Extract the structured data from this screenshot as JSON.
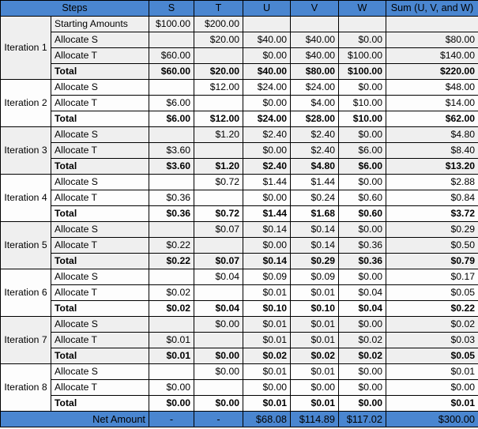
{
  "table": {
    "headers": [
      "Steps",
      "S",
      "T",
      "U",
      "V",
      "W",
      "Sum (U, V, and W)"
    ],
    "colors": {
      "header_blue": "#4a86d0",
      "footer_blue": "#4a86d0",
      "row_shade": "#efefef",
      "row_plain": "#fdfdfd",
      "border": "#000000"
    },
    "blocks": [
      {
        "iteration": "Iteration 1",
        "shaded": true,
        "rows": [
          {
            "step": "Starting Amounts",
            "total": false,
            "values": [
              "$100.00",
              "$200.00",
              "",
              "",
              "",
              ""
            ]
          },
          {
            "step": "Allocate S",
            "total": false,
            "values": [
              "",
              "$20.00",
              "$40.00",
              "$40.00",
              "$0.00",
              "$80.00"
            ]
          },
          {
            "step": "Allocate T",
            "total": false,
            "values": [
              "$60.00",
              "",
              "$0.00",
              "$40.00",
              "$100.00",
              "$140.00"
            ]
          },
          {
            "step": "Total",
            "total": true,
            "values": [
              "$60.00",
              "$20.00",
              "$40.00",
              "$80.00",
              "$100.00",
              "$220.00"
            ]
          }
        ]
      },
      {
        "iteration": "Iteration 2",
        "shaded": false,
        "rows": [
          {
            "step": "Allocate S",
            "total": false,
            "values": [
              "",
              "$12.00",
              "$24.00",
              "$24.00",
              "$0.00",
              "$48.00"
            ]
          },
          {
            "step": "Allocate T",
            "total": false,
            "values": [
              "$6.00",
              "",
              "$0.00",
              "$4.00",
              "$10.00",
              "$14.00"
            ]
          },
          {
            "step": "Total",
            "total": true,
            "values": [
              "$6.00",
              "$12.00",
              "$24.00",
              "$28.00",
              "$10.00",
              "$62.00"
            ]
          }
        ]
      },
      {
        "iteration": "Iteration 3",
        "shaded": true,
        "rows": [
          {
            "step": "Allocate S",
            "total": false,
            "values": [
              "",
              "$1.20",
              "$2.40",
              "$2.40",
              "$0.00",
              "$4.80"
            ]
          },
          {
            "step": "Allocate T",
            "total": false,
            "values": [
              "$3.60",
              "",
              "$0.00",
              "$2.40",
              "$6.00",
              "$8.40"
            ]
          },
          {
            "step": "Total",
            "total": true,
            "values": [
              "$3.60",
              "$1.20",
              "$2.40",
              "$4.80",
              "$6.00",
              "$13.20"
            ]
          }
        ]
      },
      {
        "iteration": "Iteration 4",
        "shaded": false,
        "rows": [
          {
            "step": "Allocate S",
            "total": false,
            "values": [
              "",
              "$0.72",
              "$1.44",
              "$1.44",
              "$0.00",
              "$2.88"
            ]
          },
          {
            "step": "Allocate T",
            "total": false,
            "values": [
              "$0.36",
              "",
              "$0.00",
              "$0.24",
              "$0.60",
              "$0.84"
            ]
          },
          {
            "step": "Total",
            "total": true,
            "values": [
              "$0.36",
              "$0.72",
              "$1.44",
              "$1.68",
              "$0.60",
              "$3.72"
            ]
          }
        ]
      },
      {
        "iteration": "Iteration 5",
        "shaded": true,
        "rows": [
          {
            "step": "Allocate S",
            "total": false,
            "values": [
              "",
              "$0.07",
              "$0.14",
              "$0.14",
              "$0.00",
              "$0.29"
            ]
          },
          {
            "step": "Allocate T",
            "total": false,
            "values": [
              "$0.22",
              "",
              "$0.00",
              "$0.14",
              "$0.36",
              "$0.50"
            ]
          },
          {
            "step": "Total",
            "total": true,
            "values": [
              "$0.22",
              "$0.07",
              "$0.14",
              "$0.29",
              "$0.36",
              "$0.79"
            ]
          }
        ]
      },
      {
        "iteration": "Iteration 6",
        "shaded": false,
        "rows": [
          {
            "step": "Allocate S",
            "total": false,
            "values": [
              "",
              "$0.04",
              "$0.09",
              "$0.09",
              "$0.00",
              "$0.17"
            ]
          },
          {
            "step": "Allocate T",
            "total": false,
            "values": [
              "$0.02",
              "",
              "$0.01",
              "$0.01",
              "$0.04",
              "$0.05"
            ]
          },
          {
            "step": "Total",
            "total": true,
            "values": [
              "$0.02",
              "$0.04",
              "$0.10",
              "$0.10",
              "$0.04",
              "$0.22"
            ]
          }
        ]
      },
      {
        "iteration": "Iteration 7",
        "shaded": true,
        "rows": [
          {
            "step": "Allocate S",
            "total": false,
            "values": [
              "",
              "$0.00",
              "$0.01",
              "$0.01",
              "$0.00",
              "$0.02"
            ]
          },
          {
            "step": "Allocate T",
            "total": false,
            "values": [
              "$0.01",
              "",
              "$0.01",
              "$0.01",
              "$0.02",
              "$0.03"
            ]
          },
          {
            "step": "Total",
            "total": true,
            "values": [
              "$0.01",
              "$0.00",
              "$0.02",
              "$0.02",
              "$0.02",
              "$0.05"
            ]
          }
        ]
      },
      {
        "iteration": "Iteration 8",
        "shaded": false,
        "rows": [
          {
            "step": "Allocate S",
            "total": false,
            "values": [
              "",
              "$0.00",
              "$0.01",
              "$0.01",
              "$0.00",
              "$0.01"
            ]
          },
          {
            "step": "Allocate T",
            "total": false,
            "values": [
              "$0.00",
              "",
              "$0.00",
              "$0.00",
              "$0.00",
              "$0.00"
            ]
          },
          {
            "step": "Total",
            "total": true,
            "values": [
              "$0.00",
              "$0.00",
              "$0.01",
              "$0.01",
              "$0.00",
              "$0.01"
            ]
          }
        ]
      }
    ],
    "footer": {
      "label": "Net Amount",
      "values": [
        "-",
        "-",
        "$68.08",
        "$114.89",
        "$117.02",
        "$300.00"
      ]
    }
  }
}
